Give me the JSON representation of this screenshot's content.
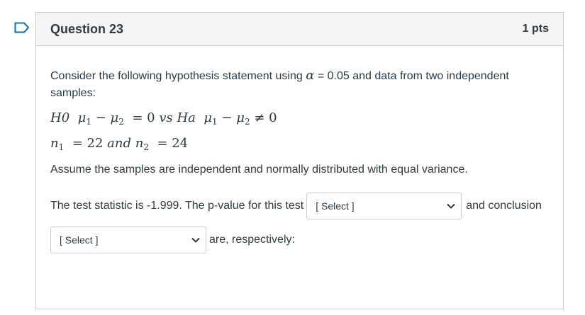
{
  "question": {
    "title": "Question 23",
    "points": "1 pts"
  },
  "body": {
    "intro_pre": "Consider the following hypothesis statement using",
    "alpha_symbol": "α",
    "alpha_eq": "= 0.05",
    "intro_post": "and data from two independent samples:",
    "hypothesis": {
      "h0": "H0",
      "mu1": "μ",
      "minus": "−",
      "mu2": "μ",
      "eq0": "= 0",
      "vs": "vs",
      "ha": "Ha",
      "neq0": "≠ 0",
      "sub1": "1",
      "sub2": "2"
    },
    "samples": {
      "n1": "n",
      "n1_sub": "1",
      "n1_eq": "= 22",
      "and": "and",
      "n2": "n",
      "n2_sub": "2",
      "n2_eq": "= 24"
    },
    "assume": "Assume the samples are independent and normally distributed with equal variance.",
    "test_stat_text": "The test statistic is -1.999. The p-value for this test",
    "after_select1": "and conclusion",
    "after_select2": "are, respectively:"
  },
  "selects": {
    "pvalue": "[ Select ]",
    "conclusion": "[ Select ]"
  },
  "icons": {
    "flag": "bookmark-flag-icon",
    "chevron": "chevron-down-icon"
  },
  "colors": {
    "flag": "#0374b5",
    "border": "#c7cdd1",
    "header_bg": "#f5f5f5",
    "text": "#2d3b45"
  }
}
